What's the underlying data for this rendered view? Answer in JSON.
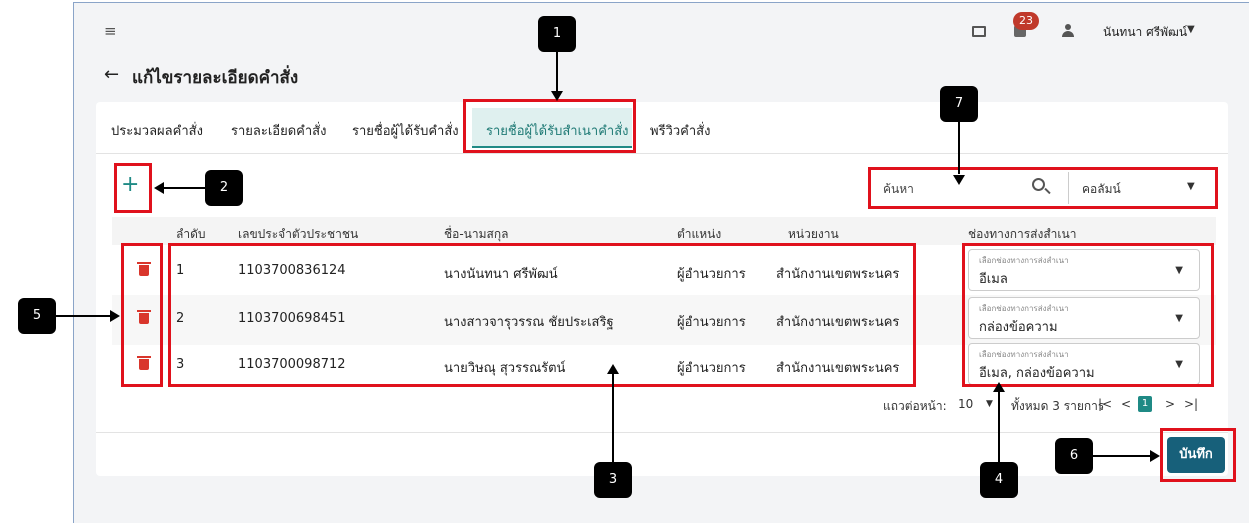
{
  "header": {
    "notification_count": "23",
    "user_name": "นันทนา ศรีพัฒน์"
  },
  "page": {
    "title": "แก้ไขรายละเอียดคำสั่ง"
  },
  "tabs": [
    {
      "label": "ประมวลผลคำสั่ง"
    },
    {
      "label": "รายละเอียดคำสั่ง"
    },
    {
      "label": "รายชื่อผู้ได้รับคำสั่ง"
    },
    {
      "label": "รายชื่อผู้ได้รับสำเนาคำสั่ง",
      "active": true
    },
    {
      "label": "พรีวิวคำสั่ง"
    }
  ],
  "toolbar": {
    "add_icon": "plus-icon",
    "search_placeholder": "ค้นหา",
    "column_select": "คอลัมน์"
  },
  "table": {
    "headers": [
      "ลำดับ",
      "เลขประจำตัวประชาชน",
      "ชื่อ-นามสกุล",
      "ตำแหน่ง",
      "หน่วยงาน",
      "ช่องทางการส่งสำเนา"
    ],
    "channel_field_label": "เลือกช่องทางการส่งสำเนา",
    "rows": [
      {
        "no": "1",
        "id": "1103700836124",
        "name": "นางนันทนา ศรีพัฒน์",
        "position": "ผู้อำนวยการ",
        "unit": "สำนักงานเขตพระนคร",
        "channel": "อีเมล"
      },
      {
        "no": "2",
        "id": "1103700698451",
        "name": "นางสาวจารุวรรณ ชัยประเสริฐ",
        "position": "ผู้อำนวยการ",
        "unit": "สำนักงานเขตพระนคร",
        "channel": "กล่องข้อความ"
      },
      {
        "no": "3",
        "id": "1103700098712",
        "name": "นายวิษณุ สุวรรณรัตน์",
        "position": "ผู้อำนวยการ",
        "unit": "สำนักงานเขตพระนคร",
        "channel": "อีเมล, กล่องข้อความ"
      }
    ]
  },
  "pagination": {
    "rows_per_page_label": "แถวต่อหน้า:",
    "rows_per_page": "10",
    "total_label": "ทั้งหมด 3 รายการ",
    "current_page": "1"
  },
  "actions": {
    "save_label": "บันทึก"
  },
  "annotations": [
    "1",
    "2",
    "3",
    "4",
    "5",
    "6",
    "7"
  ],
  "colors": {
    "accent": "#1f8a85",
    "save_button": "#17607a",
    "delete": "#d9362c",
    "highlight": "#e0111c",
    "badge": "#c0392b"
  }
}
